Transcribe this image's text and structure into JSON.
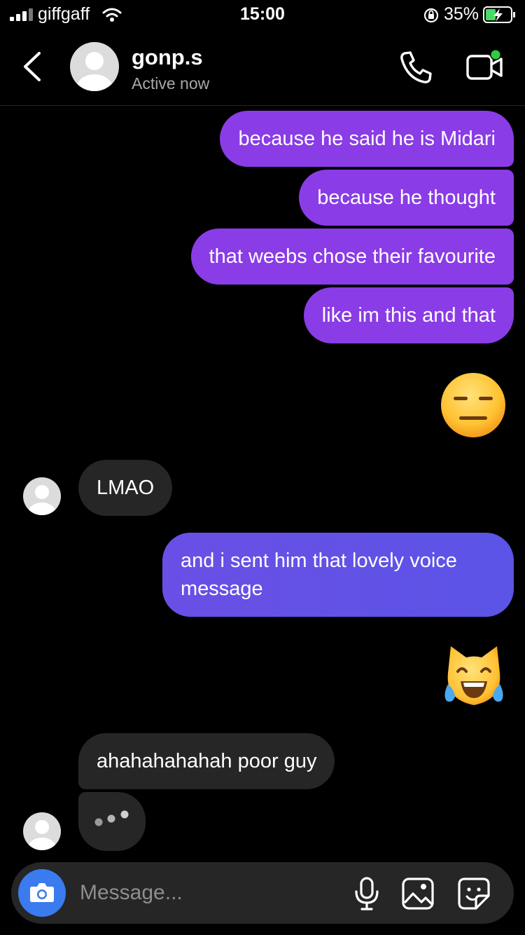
{
  "status_bar": {
    "carrier": "giffgaff",
    "time": "15:00",
    "battery_percent": "35%",
    "icons": [
      "signal-icon",
      "wifi-icon",
      "orientation-lock-icon",
      "battery-charging-icon"
    ]
  },
  "header": {
    "username": "gonp.s",
    "status": "Active now",
    "icons": [
      "back-chevron-icon",
      "phone-icon",
      "video-call-icon"
    ],
    "online_dot_color": "#2ecc40"
  },
  "messages": [
    {
      "from": "me",
      "text": "because he said he is Midari"
    },
    {
      "from": "me",
      "text": "because he thought"
    },
    {
      "from": "me",
      "text": "that weebs chose their favourite"
    },
    {
      "from": "me",
      "text": "like im this and that"
    },
    {
      "from": "me",
      "emoji": "😑",
      "icon": "expressionless-face-emoji"
    },
    {
      "from": "them",
      "text": "LMAO"
    },
    {
      "from": "me",
      "text": "and i sent him that lovely voice message"
    },
    {
      "from": "me",
      "emoji": "😹",
      "icon": "cat-tears-of-joy-emoji"
    },
    {
      "from": "them",
      "text": "ahahahahahah poor guy"
    },
    {
      "from": "them",
      "typing": true,
      "icon": "typing-indicator-icon"
    }
  ],
  "composer": {
    "placeholder": "Message...",
    "icons": [
      "camera-icon",
      "microphone-icon",
      "gallery-icon",
      "sticker-icon"
    ]
  },
  "colors": {
    "background": "#000000",
    "sent_bubble": "#8a3ce6",
    "sent_bubble_gradient_end": "#5b54e6",
    "received_bubble": "#262626",
    "camera_button": "#3a7bf0",
    "secondary_text": "#a8a8a8"
  }
}
